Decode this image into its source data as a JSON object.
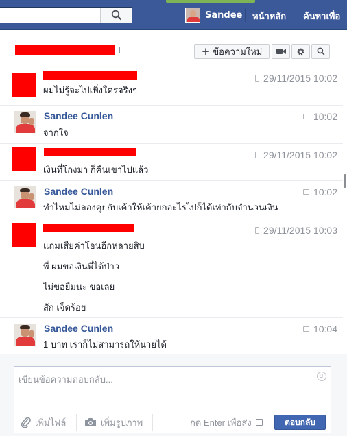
{
  "topbar": {
    "user_name": "Sandee",
    "nav_home": "หน้าหลัก",
    "nav_find_friends": "ค้นหาเพื่อ"
  },
  "conversation": {
    "new_message_label": "ข้อความใหม่"
  },
  "messages": [
    {
      "sender": "",
      "sender_redacted": true,
      "time": "29/11/2015 10:02",
      "time_icon": "mobile-icon",
      "lines": [
        "ผมไม่รู้จะไปเพิ่งใครจริงๆ"
      ]
    },
    {
      "sender": "Sandee Cunlen",
      "sender_redacted": false,
      "time": "10:02",
      "time_icon": "chat-icon",
      "lines": [
        "จากใจ"
      ]
    },
    {
      "sender": "",
      "sender_redacted": true,
      "time": "29/11/2015 10:02",
      "time_icon": "mobile-icon",
      "lines": [
        "เงินที่โกงมา ก็คืนเขาไปแล้ว"
      ]
    },
    {
      "sender": "Sandee Cunlen",
      "sender_redacted": false,
      "time": "10:02",
      "time_icon": "chat-icon",
      "lines": [
        "ทำไหมไม่ลองคุยกับเค้าให้เค้ายกอะไรไปก็ได้เท่ากับจำนวนเงิน"
      ]
    },
    {
      "sender": "",
      "sender_redacted": true,
      "time": "29/11/2015 10:03",
      "time_icon": "mobile-icon",
      "lines": [
        "แถมเสียค่าโอนอีกหลายสิบ",
        "พี่ ผมขอเงินพี่ได้ป่าว",
        "ไม่ขอยืมนะ ขอเลย",
        "สัก เจ็ดร้อย"
      ]
    },
    {
      "sender": "Sandee Cunlen",
      "sender_redacted": false,
      "time": "10:04",
      "time_icon": "chat-icon",
      "lines": [
        "1 บาท เราก็ไม่สามารถให้นายได้"
      ]
    }
  ],
  "composer": {
    "placeholder": "เขียนข้อความตอบกลับ...",
    "attach_file_label": "เพิ่มไฟล์",
    "add_photo_label": "เพิ่มรูปภาพ",
    "enter_to_send_label": "กด Enter เพื่อส่ง",
    "reply_label": "ตอบกลับ"
  },
  "colors": {
    "topbar": "#3b5998",
    "link": "#365899",
    "button": "#4267b2",
    "redaction": "#ff0000"
  }
}
